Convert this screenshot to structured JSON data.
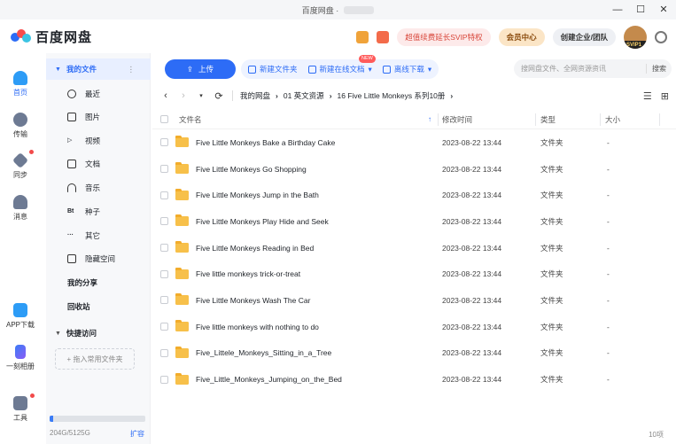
{
  "window": {
    "title": "百度网盘 ·",
    "controls": [
      "—",
      "☐",
      "✕"
    ]
  },
  "header": {
    "app_name": "百度网盘",
    "svip_promo": "超值续费延长SVIP特权",
    "vip_center": "会员中心",
    "enterprise": "创建企业/团队",
    "avatar_badge": "SVIP1"
  },
  "leftnav": [
    {
      "label": "首页",
      "icon": "cloud-icon"
    },
    {
      "label": "传输",
      "icon": "transfer-icon"
    },
    {
      "label": "同步",
      "icon": "sync-icon"
    },
    {
      "label": "消息",
      "icon": "people-icon"
    },
    {
      "label": "APP下载",
      "icon": "app-icon"
    },
    {
      "label": "一刻相册",
      "icon": "album-icon"
    },
    {
      "label": "工具",
      "icon": "tools-icon"
    }
  ],
  "sidebar": {
    "my_files": "我的文件",
    "more": "⋮",
    "items": [
      {
        "label": "最近",
        "icon": "clock-icon"
      },
      {
        "label": "图片",
        "icon": "image-icon"
      },
      {
        "label": "视频",
        "icon": "play-icon"
      },
      {
        "label": "文档",
        "icon": "doc-icon"
      },
      {
        "label": "音乐",
        "icon": "headphone-icon"
      },
      {
        "label": "种子",
        "glyph": "Bt"
      },
      {
        "label": "其它",
        "glyph": "···"
      },
      {
        "label": "隐藏空间",
        "icon": "lock-icon"
      }
    ],
    "my_share": "我的分享",
    "recycle": "回收站",
    "quick_access": "快捷访问",
    "add_folder": "+ 拖入常用文件夹",
    "storage_text": "204G/5125G",
    "storage_used_fraction": 0.04,
    "expand_label": "扩容"
  },
  "toolbar": {
    "upload": "上传",
    "new_folder": "新建文件夹",
    "new_online_doc": "新建在线文档",
    "new_badge": "NEW",
    "offline_download": "离线下载"
  },
  "search": {
    "placeholder": "搜网盘文件、全网资源资讯",
    "button": "搜索"
  },
  "breadcrumb": {
    "items": [
      "我的网盘",
      "01 英文资源",
      "16 Five Little Monkeys 系列10册"
    ]
  },
  "table": {
    "headers": {
      "name": "文件名",
      "time": "修改时间",
      "type": "类型",
      "size": "大小"
    },
    "rows": [
      {
        "name": "Five Little Monkeys Bake a Birthday Cake",
        "time": "2023-08-22 13:44",
        "type": "文件夹",
        "size": "-"
      },
      {
        "name": "Five Little Monkeys Go Shopping",
        "time": "2023-08-22 13:44",
        "type": "文件夹",
        "size": "-"
      },
      {
        "name": "Five Little Monkeys Jump in the Bath",
        "time": "2023-08-22 13:44",
        "type": "文件夹",
        "size": "-"
      },
      {
        "name": "Five Little Monkeys Play Hide and Seek",
        "time": "2023-08-22 13:44",
        "type": "文件夹",
        "size": "-"
      },
      {
        "name": "Five Little Monkeys Reading in Bed",
        "time": "2023-08-22 13:44",
        "type": "文件夹",
        "size": "-"
      },
      {
        "name": "Five little monkeys trick-or-treat",
        "time": "2023-08-22 13:44",
        "type": "文件夹",
        "size": "-"
      },
      {
        "name": "Five Little Monkeys Wash The Car",
        "time": "2023-08-22 13:44",
        "type": "文件夹",
        "size": "-"
      },
      {
        "name": "Five little monkeys with nothing to do",
        "time": "2023-08-22 13:44",
        "type": "文件夹",
        "size": "-"
      },
      {
        "name": "Five_Littele_Monkeys_Sitting_in_a_Tree",
        "time": "2023-08-22 13:44",
        "type": "文件夹",
        "size": "-"
      },
      {
        "name": "Five_Little_Monkeys_Jumping_on_the_Bed",
        "time": "2023-08-22 13:44",
        "type": "文件夹",
        "size": "-"
      }
    ],
    "count_text": "10项"
  },
  "colors": {
    "accent": "#2d6cf6",
    "folder": "#f7c04a",
    "svip_text": "#d8463a"
  }
}
